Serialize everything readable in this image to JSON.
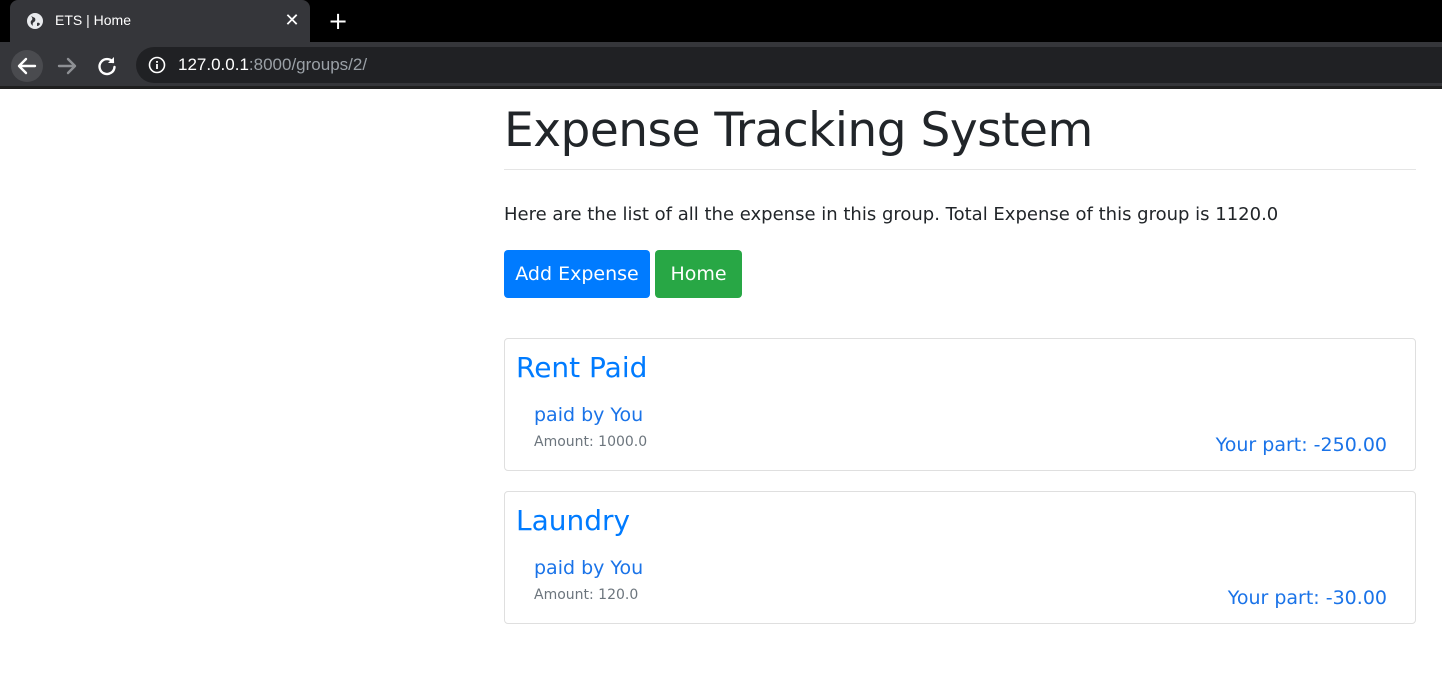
{
  "browser": {
    "tab_title": "ETS | Home",
    "tab_close": "✕",
    "new_tab": "+",
    "url_host": "127.0.0.1",
    "url_path": ":8000/groups/2/"
  },
  "page": {
    "title": "Expense Tracking System",
    "lead": "Here are the list of all the expense in this group. Total Expense of this group is 1120.0",
    "buttons": {
      "add_expense": "Add Expense",
      "home": "Home"
    },
    "expenses": [
      {
        "title": "Rent Paid",
        "paid_by": "paid by You",
        "amount": "Amount: 1000.0",
        "your_part": "Your part: -250.00"
      },
      {
        "title": "Laundry",
        "paid_by": "paid by You",
        "amount": "Amount: 120.0",
        "your_part": "Your part: -30.00"
      }
    ]
  },
  "colors": {
    "primary": "#007bff",
    "success": "#28a745",
    "link": "#1a73e8",
    "muted": "#6c757d"
  }
}
